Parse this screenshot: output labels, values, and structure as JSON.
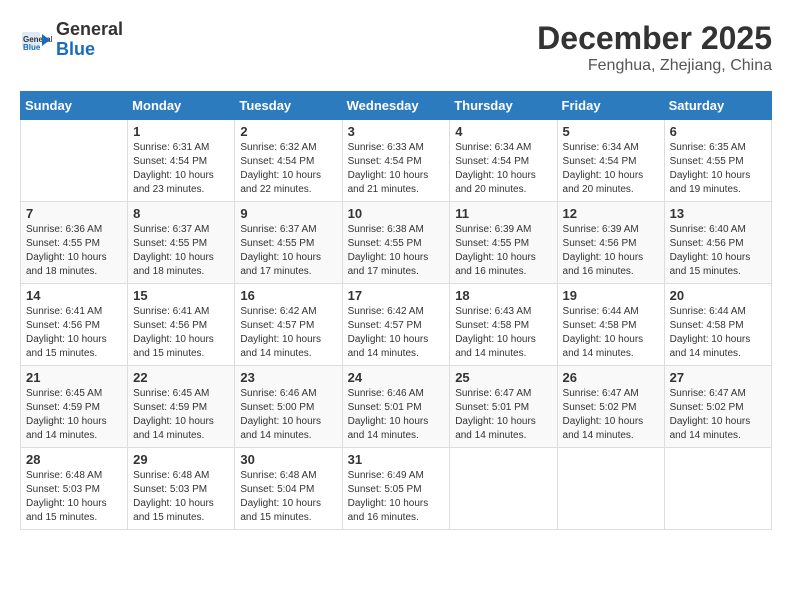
{
  "header": {
    "logo_general": "General",
    "logo_blue": "Blue",
    "month_title": "December 2025",
    "location": "Fenghua, Zhejiang, China"
  },
  "days_of_week": [
    "Sunday",
    "Monday",
    "Tuesday",
    "Wednesday",
    "Thursday",
    "Friday",
    "Saturday"
  ],
  "weeks": [
    [
      {
        "day": "",
        "info": ""
      },
      {
        "day": "1",
        "info": "Sunrise: 6:31 AM\nSunset: 4:54 PM\nDaylight: 10 hours and 23 minutes."
      },
      {
        "day": "2",
        "info": "Sunrise: 6:32 AM\nSunset: 4:54 PM\nDaylight: 10 hours and 22 minutes."
      },
      {
        "day": "3",
        "info": "Sunrise: 6:33 AM\nSunset: 4:54 PM\nDaylight: 10 hours and 21 minutes."
      },
      {
        "day": "4",
        "info": "Sunrise: 6:34 AM\nSunset: 4:54 PM\nDaylight: 10 hours and 20 minutes."
      },
      {
        "day": "5",
        "info": "Sunrise: 6:34 AM\nSunset: 4:54 PM\nDaylight: 10 hours and 20 minutes."
      },
      {
        "day": "6",
        "info": "Sunrise: 6:35 AM\nSunset: 4:55 PM\nDaylight: 10 hours and 19 minutes."
      }
    ],
    [
      {
        "day": "7",
        "info": "Sunrise: 6:36 AM\nSunset: 4:55 PM\nDaylight: 10 hours and 18 minutes."
      },
      {
        "day": "8",
        "info": "Sunrise: 6:37 AM\nSunset: 4:55 PM\nDaylight: 10 hours and 18 minutes."
      },
      {
        "day": "9",
        "info": "Sunrise: 6:37 AM\nSunset: 4:55 PM\nDaylight: 10 hours and 17 minutes."
      },
      {
        "day": "10",
        "info": "Sunrise: 6:38 AM\nSunset: 4:55 PM\nDaylight: 10 hours and 17 minutes."
      },
      {
        "day": "11",
        "info": "Sunrise: 6:39 AM\nSunset: 4:55 PM\nDaylight: 10 hours and 16 minutes."
      },
      {
        "day": "12",
        "info": "Sunrise: 6:39 AM\nSunset: 4:56 PM\nDaylight: 10 hours and 16 minutes."
      },
      {
        "day": "13",
        "info": "Sunrise: 6:40 AM\nSunset: 4:56 PM\nDaylight: 10 hours and 15 minutes."
      }
    ],
    [
      {
        "day": "14",
        "info": "Sunrise: 6:41 AM\nSunset: 4:56 PM\nDaylight: 10 hours and 15 minutes."
      },
      {
        "day": "15",
        "info": "Sunrise: 6:41 AM\nSunset: 4:56 PM\nDaylight: 10 hours and 15 minutes."
      },
      {
        "day": "16",
        "info": "Sunrise: 6:42 AM\nSunset: 4:57 PM\nDaylight: 10 hours and 14 minutes."
      },
      {
        "day": "17",
        "info": "Sunrise: 6:42 AM\nSunset: 4:57 PM\nDaylight: 10 hours and 14 minutes."
      },
      {
        "day": "18",
        "info": "Sunrise: 6:43 AM\nSunset: 4:58 PM\nDaylight: 10 hours and 14 minutes."
      },
      {
        "day": "19",
        "info": "Sunrise: 6:44 AM\nSunset: 4:58 PM\nDaylight: 10 hours and 14 minutes."
      },
      {
        "day": "20",
        "info": "Sunrise: 6:44 AM\nSunset: 4:58 PM\nDaylight: 10 hours and 14 minutes."
      }
    ],
    [
      {
        "day": "21",
        "info": "Sunrise: 6:45 AM\nSunset: 4:59 PM\nDaylight: 10 hours and 14 minutes."
      },
      {
        "day": "22",
        "info": "Sunrise: 6:45 AM\nSunset: 4:59 PM\nDaylight: 10 hours and 14 minutes."
      },
      {
        "day": "23",
        "info": "Sunrise: 6:46 AM\nSunset: 5:00 PM\nDaylight: 10 hours and 14 minutes."
      },
      {
        "day": "24",
        "info": "Sunrise: 6:46 AM\nSunset: 5:01 PM\nDaylight: 10 hours and 14 minutes."
      },
      {
        "day": "25",
        "info": "Sunrise: 6:47 AM\nSunset: 5:01 PM\nDaylight: 10 hours and 14 minutes."
      },
      {
        "day": "26",
        "info": "Sunrise: 6:47 AM\nSunset: 5:02 PM\nDaylight: 10 hours and 14 minutes."
      },
      {
        "day": "27",
        "info": "Sunrise: 6:47 AM\nSunset: 5:02 PM\nDaylight: 10 hours and 14 minutes."
      }
    ],
    [
      {
        "day": "28",
        "info": "Sunrise: 6:48 AM\nSunset: 5:03 PM\nDaylight: 10 hours and 15 minutes."
      },
      {
        "day": "29",
        "info": "Sunrise: 6:48 AM\nSunset: 5:03 PM\nDaylight: 10 hours and 15 minutes."
      },
      {
        "day": "30",
        "info": "Sunrise: 6:48 AM\nSunset: 5:04 PM\nDaylight: 10 hours and 15 minutes."
      },
      {
        "day": "31",
        "info": "Sunrise: 6:49 AM\nSunset: 5:05 PM\nDaylight: 10 hours and 16 minutes."
      },
      {
        "day": "",
        "info": ""
      },
      {
        "day": "",
        "info": ""
      },
      {
        "day": "",
        "info": ""
      }
    ]
  ]
}
